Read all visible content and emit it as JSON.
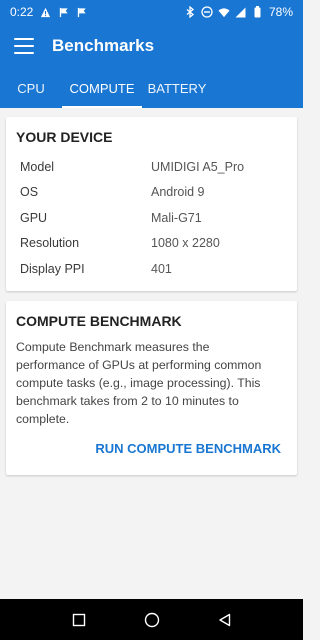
{
  "status_bar": {
    "time": "0:22",
    "battery": "78%",
    "icons": [
      "warning-icon",
      "flag-icon",
      "flag-icon",
      "bluetooth-icon",
      "dnd-icon",
      "wifi-icon",
      "signal-icon",
      "battery-icon"
    ]
  },
  "app_bar": {
    "title": "Benchmarks",
    "menu_icon": "hamburger-menu-icon"
  },
  "tabs": [
    {
      "label": "CPU",
      "selected": false
    },
    {
      "label": "COMPUTE",
      "selected": true
    },
    {
      "label": "BATTERY",
      "selected": false
    }
  ],
  "device_card": {
    "title": "YOUR DEVICE",
    "rows": [
      {
        "key": "Model",
        "value": "UMIDIGI A5_Pro"
      },
      {
        "key": "OS",
        "value": "Android 9"
      },
      {
        "key": "GPU",
        "value": "Mali-G71"
      },
      {
        "key": "Resolution",
        "value": "1080 x 2280"
      },
      {
        "key": "Display PPI",
        "value": "401"
      }
    ]
  },
  "compute_card": {
    "title": "COMPUTE BENCHMARK",
    "description_lines": [
      "Compute Benchmark measures the",
      "performance of GPUs at performing common",
      "compute tasks (e.g., image processing). This",
      "benchmark takes from 2 to 10 minutes to",
      "complete."
    ],
    "run_button": "RUN COMPUTE BENCHMARK"
  },
  "nav_bar": {
    "icons": [
      "recent-apps-icon",
      "home-icon",
      "back-icon"
    ]
  },
  "colors": {
    "primary": "#1976d2",
    "background": "#f3f3f3",
    "card": "#ffffff"
  }
}
